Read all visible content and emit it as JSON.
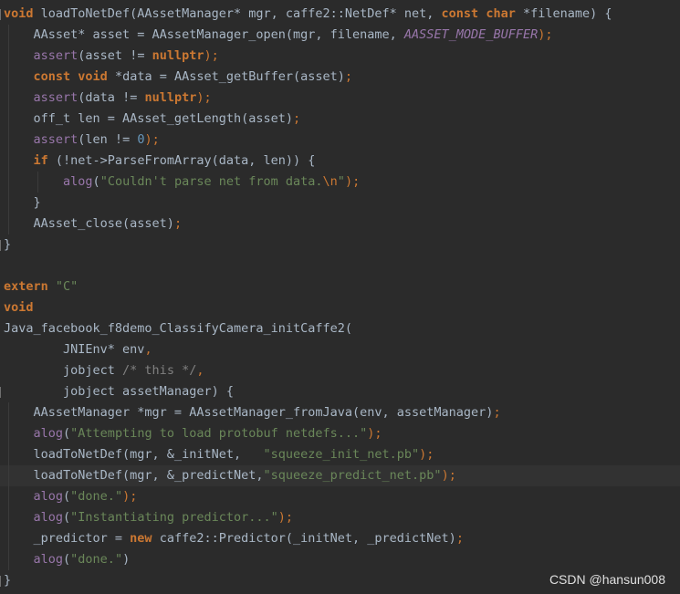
{
  "editor": {
    "lines": [
      [
        {
          "t": "void",
          "c": "kw"
        },
        {
          "t": " loadToNetDef(AAssetManager* mgr, caffe2::NetDef* net, ",
          "c": ""
        },
        {
          "t": "const",
          "c": "kw"
        },
        {
          "t": " ",
          "c": ""
        },
        {
          "t": "char",
          "c": "kw"
        },
        {
          "t": " *filename) {",
          "c": ""
        }
      ],
      [
        {
          "t": "    AAsset* asset = AAssetManager_open(mgr, filename, ",
          "c": ""
        },
        {
          "t": "AASSET_MODE_BUFFER",
          "c": "fn-purple-i"
        },
        {
          "t": ");",
          "c": "punct"
        }
      ],
      [
        {
          "t": "    ",
          "c": ""
        },
        {
          "t": "assert",
          "c": "fn-purple"
        },
        {
          "t": "(asset != ",
          "c": ""
        },
        {
          "t": "nullptr",
          "c": "kw"
        },
        {
          "t": ");",
          "c": "punct"
        }
      ],
      [
        {
          "t": "    ",
          "c": ""
        },
        {
          "t": "const",
          "c": "kw"
        },
        {
          "t": " ",
          "c": ""
        },
        {
          "t": "void",
          "c": "kw"
        },
        {
          "t": " *data = AAsset_getBuffer(asset)",
          "c": ""
        },
        {
          "t": ";",
          "c": "punct"
        }
      ],
      [
        {
          "t": "    ",
          "c": ""
        },
        {
          "t": "assert",
          "c": "fn-purple"
        },
        {
          "t": "(data != ",
          "c": ""
        },
        {
          "t": "nullptr",
          "c": "kw"
        },
        {
          "t": ");",
          "c": "punct"
        }
      ],
      [
        {
          "t": "    off_t len = AAsset_getLength(asset)",
          "c": ""
        },
        {
          "t": ";",
          "c": "punct"
        }
      ],
      [
        {
          "t": "    ",
          "c": ""
        },
        {
          "t": "assert",
          "c": "fn-purple"
        },
        {
          "t": "(len != ",
          "c": ""
        },
        {
          "t": "0",
          "c": "num"
        },
        {
          "t": ");",
          "c": "punct"
        }
      ],
      [
        {
          "t": "    ",
          "c": ""
        },
        {
          "t": "if",
          "c": "kw"
        },
        {
          "t": " (!net->ParseFromArray(data, len)) {",
          "c": ""
        }
      ],
      [
        {
          "t": "        ",
          "c": ""
        },
        {
          "t": "alog",
          "c": "fn-purple"
        },
        {
          "t": "(",
          "c": ""
        },
        {
          "t": "\"Couldn't parse net from data.",
          "c": "str"
        },
        {
          "t": "\\n",
          "c": "punct"
        },
        {
          "t": "\"",
          "c": "str"
        },
        {
          "t": ");",
          "c": "punct"
        }
      ],
      [
        {
          "t": "    }",
          "c": ""
        }
      ],
      [
        {
          "t": "    AAsset_close(asset)",
          "c": ""
        },
        {
          "t": ";",
          "c": "punct"
        }
      ],
      [
        {
          "t": "}",
          "c": ""
        }
      ],
      [],
      [
        {
          "t": "extern",
          "c": "kw"
        },
        {
          "t": " ",
          "c": ""
        },
        {
          "t": "\"C\"",
          "c": "str"
        }
      ],
      [
        {
          "t": "void",
          "c": "kw"
        }
      ],
      [
        {
          "t": "Java_facebook_f8demo_ClassifyCamera_initCaffe2(",
          "c": ""
        }
      ],
      [
        {
          "t": "        JNIEnv* env",
          "c": ""
        },
        {
          "t": ",",
          "c": "punct"
        }
      ],
      [
        {
          "t": "        jobject ",
          "c": ""
        },
        {
          "t": "/* this */",
          "c": "cmt"
        },
        {
          "t": ",",
          "c": "punct"
        }
      ],
      [
        {
          "t": "        jobject assetManager) {",
          "c": ""
        }
      ],
      [
        {
          "t": "    AAssetManager *mgr = AAssetManager_fromJava(env, assetManager)",
          "c": ""
        },
        {
          "t": ";",
          "c": "punct"
        }
      ],
      [
        {
          "t": "    ",
          "c": ""
        },
        {
          "t": "alog",
          "c": "fn-purple"
        },
        {
          "t": "(",
          "c": ""
        },
        {
          "t": "\"Attempting to load protobuf netdefs...\"",
          "c": "str"
        },
        {
          "t": ");",
          "c": "punct"
        }
      ],
      [
        {
          "t": "    loadToNetDef(mgr, &_initNet,   ",
          "c": ""
        },
        {
          "t": "\"squeeze_init_net.pb\"",
          "c": "str"
        },
        {
          "t": ");",
          "c": "punct"
        }
      ],
      [
        {
          "t": "    loadToNetDef(mgr, &_predictNet,",
          "c": ""
        },
        {
          "t": "\"squeeze_predict_net.pb\"",
          "c": "str"
        },
        {
          "t": ");",
          "c": "punct"
        }
      ],
      [
        {
          "t": "    ",
          "c": ""
        },
        {
          "t": "alog",
          "c": "fn-purple"
        },
        {
          "t": "(",
          "c": ""
        },
        {
          "t": "\"done.\"",
          "c": "str"
        },
        {
          "t": ");",
          "c": "punct"
        }
      ],
      [
        {
          "t": "    ",
          "c": ""
        },
        {
          "t": "alog",
          "c": "fn-purple"
        },
        {
          "t": "(",
          "c": ""
        },
        {
          "t": "\"Instantiating predictor...\"",
          "c": "str"
        },
        {
          "t": ");",
          "c": "punct"
        }
      ],
      [
        {
          "t": "    _predictor = ",
          "c": ""
        },
        {
          "t": "new",
          "c": "kw"
        },
        {
          "t": " caffe2::Predictor(_initNet, _predictNet)",
          "c": ""
        },
        {
          "t": ";",
          "c": "punct"
        }
      ],
      [
        {
          "t": "    ",
          "c": ""
        },
        {
          "t": "alog",
          "c": "fn-purple"
        },
        {
          "t": "(",
          "c": ""
        },
        {
          "t": "\"done.\"",
          "c": "str"
        },
        {
          "t": ")",
          "c": ""
        }
      ],
      [
        {
          "t": "}",
          "c": ""
        }
      ]
    ],
    "current_line_index": 22
  },
  "watermark": "CSDN @hansun008"
}
